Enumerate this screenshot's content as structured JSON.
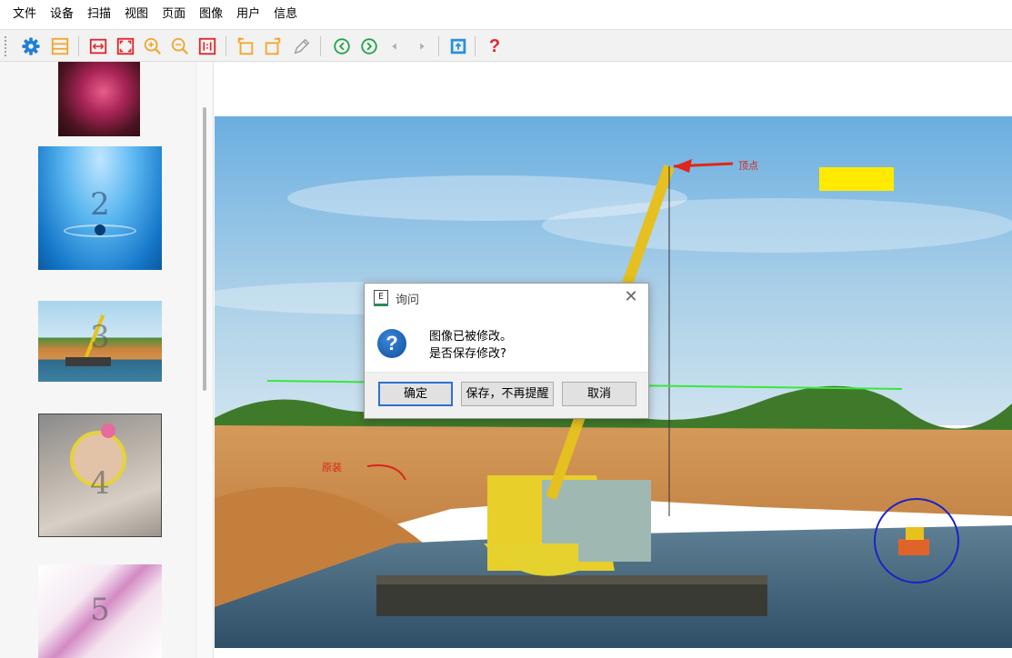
{
  "menu": [
    "文件",
    "设备",
    "扫描",
    "视图",
    "页面",
    "图像",
    "用户",
    "信息"
  ],
  "toolbar": {
    "icons": [
      "gear-icon",
      "scan-layout-icon",
      "fit-width-icon",
      "fit-page-icon",
      "zoom-in-icon",
      "zoom-out-icon",
      "actual-size-icon",
      "rotate-left-icon",
      "rotate-right-icon",
      "pen-icon",
      "previous-page-icon",
      "next-page-icon",
      "arrow-left-icon",
      "arrow-right-icon",
      "export-icon",
      "help-icon"
    ],
    "help_label": "?"
  },
  "thumbnails": [
    {
      "number": ""
    },
    {
      "number": "2"
    },
    {
      "number": "3"
    },
    {
      "number": "4"
    },
    {
      "number": "5"
    }
  ],
  "annotations": {
    "apex_label": "顶点",
    "left_label": "原装"
  },
  "dialog": {
    "title": "询问",
    "app_icon_letter": "E",
    "close_glyph": "✕",
    "question_glyph": "?",
    "message_line1": "图像已被修改。",
    "message_line2": "是否保存修改?",
    "buttons": {
      "ok": "确定",
      "save_no_remind": "保存，不再提醒",
      "cancel": "取消"
    }
  },
  "colors": {
    "accent_blue": "#1e7fd6",
    "toolbar_red": "#e0252b",
    "toolbar_orange": "#f2a62b",
    "toolbar_green": "#22a44a",
    "annotation_yellow": "#ffea00",
    "annotation_green": "#39e83b",
    "annotation_circle": "#1b22c9"
  }
}
